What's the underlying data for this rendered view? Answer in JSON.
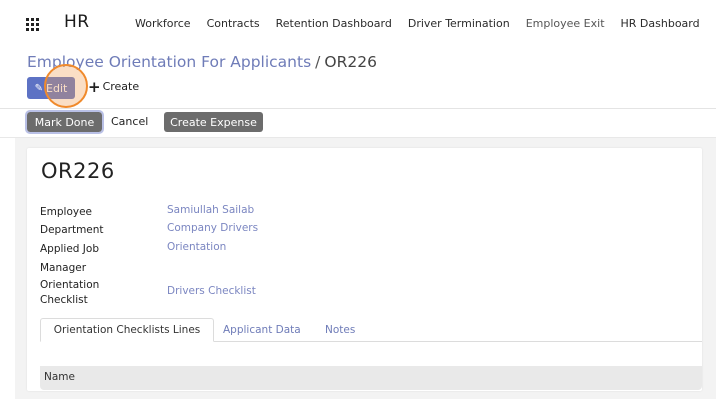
{
  "navbar": {
    "brand": "HR",
    "menu": [
      {
        "label": "Workforce"
      },
      {
        "label": "Contracts"
      },
      {
        "label": "Retention Dashboard"
      },
      {
        "label": "Driver Termination"
      },
      {
        "label": "Employee Exit"
      },
      {
        "label": "HR Dashboard"
      }
    ]
  },
  "breadcrumb": {
    "parent": "Employee Orientation For Applicants",
    "separator": "/",
    "current": "OR226"
  },
  "actions": {
    "edit_label": "Edit",
    "create_label": "Create"
  },
  "statusbar": {
    "mark_done": "Mark Done",
    "cancel": "Cancel",
    "create_expense": "Create Expense"
  },
  "record": {
    "title": "OR226",
    "fields": [
      {
        "label": "Employee",
        "value": "Samiullah Sailab"
      },
      {
        "label": "Department",
        "value": "Company Drivers"
      },
      {
        "label": "Applied Job",
        "value": "Orientation"
      },
      {
        "label": "Manager",
        "value": ""
      },
      {
        "label": "Orientation Checklist",
        "value": "Drivers Checklist"
      }
    ]
  },
  "tabs": [
    {
      "label": "Orientation Checklists Lines"
    },
    {
      "label": "Applicant Data"
    },
    {
      "label": "Notes"
    }
  ],
  "table": {
    "columns": [
      "Name"
    ]
  }
}
